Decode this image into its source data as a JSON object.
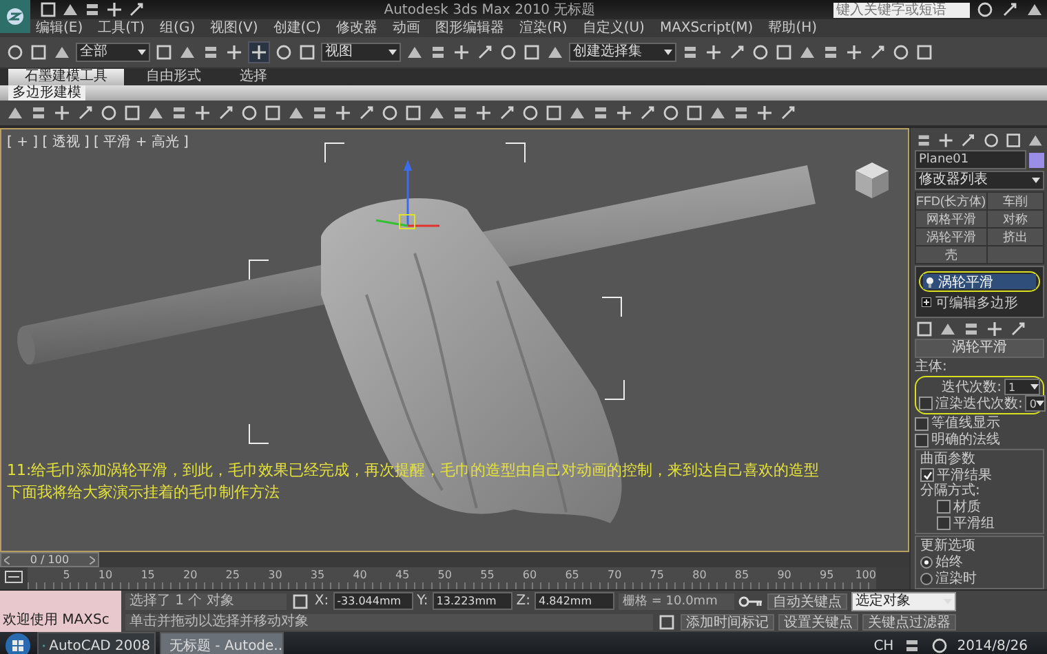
{
  "title_bar": {
    "title": "Autodesk 3ds Max 2010  无标题",
    "search": {
      "placeholder": "键入关键字或短语"
    }
  },
  "menu": [
    "编辑(E)",
    "工具(T)",
    "组(G)",
    "视图(V)",
    "创建(C)",
    "修改器",
    "动画",
    "图形编辑器",
    "渲染(R)",
    "自定义(U)",
    "MAXScript(M)",
    "帮助(H)"
  ],
  "main_toolbar": {
    "selection_filter": "全部",
    "reference_coord": "视图",
    "named_selection": "创建选择集"
  },
  "ribbon": {
    "tabs": [
      {
        "label": "石墨建模工具",
        "selected": true
      },
      {
        "label": "自由形式",
        "selected": false
      },
      {
        "label": "选择",
        "selected": false
      }
    ],
    "panel": "多边形建模"
  },
  "viewport": {
    "label": "[ + ] [ 透视 ] [ 平滑 + 高光 ]",
    "caption": [
      "11:给毛巾添加涡轮平滑，到此，毛巾效果已经完成，再次提醒，毛巾的造型由自己对动画的控制，来到达自己喜欢的造型",
      "下面我将给大家演示挂着的毛巾制作方法"
    ]
  },
  "command_panel": {
    "object_name": "Plane01",
    "modifier_list": "修改器列表",
    "modifier_buttons": [
      "FFD(长方体)",
      "车削",
      "网格平滑",
      "对称",
      "涡轮平滑",
      "挤出",
      "壳"
    ],
    "stack": [
      {
        "label": "涡轮平滑",
        "kind": "modifier",
        "selected": true
      },
      {
        "label": "可编辑多边形",
        "kind": "base",
        "selected": false
      }
    ],
    "rollout": {
      "title": "涡轮平滑",
      "section": "主体:",
      "iterations": {
        "label": "迭代次数:",
        "value": "1"
      },
      "render_iterations": {
        "label": "渲染迭代次数:",
        "value": "0",
        "checked": false
      },
      "options": [
        {
          "label": "等值线显示",
          "checked": false
        },
        {
          "label": "明确的法线",
          "checked": false
        }
      ],
      "surface": {
        "title": "曲面参数",
        "smooth_result": {
          "label": "平滑结果",
          "checked": true
        },
        "separate_by": "分隔方式:",
        "separate_options": [
          {
            "label": "材质",
            "checked": false
          },
          {
            "label": "平滑组",
            "checked": false
          }
        ]
      },
      "update": {
        "title": "更新选项",
        "options": [
          {
            "label": "始终",
            "selected": true
          },
          {
            "label": "渲染时",
            "selected": false
          }
        ]
      }
    }
  },
  "time_slider": {
    "position": "0 / 100",
    "level": 0
  },
  "ruler_labels": [
    "5",
    "10",
    "15",
    "20",
    "25",
    "30",
    "35",
    "40",
    "45",
    "50",
    "55",
    "60",
    "65",
    "70",
    "75",
    "80",
    "85",
    "90",
    "95",
    "100"
  ],
  "status": {
    "welcome": "欢迎使用 MAXSc",
    "prompt": "选择了 1 个 对象",
    "hint": "单击并拖动以选择并移动对象",
    "coords": [
      {
        "axis": "X:",
        "value": "-33.044mm"
      },
      {
        "axis": "Y:",
        "value": "13.223mm"
      },
      {
        "axis": "Z:",
        "value": "4.842mm"
      }
    ],
    "grid": "栅格 = 10.0mm",
    "add_time_tag": "添加时间标记",
    "auto_key": "自动关键点",
    "key_mode": "选定对象",
    "set_key": "设置关键点",
    "key_filters": "关键点过滤器"
  },
  "taskbar": {
    "tasks": [
      {
        "label": "AutoCAD 2008",
        "selected": false
      },
      {
        "label": "无标题 - Autode...",
        "selected": true
      }
    ],
    "language": "CH",
    "date": "2014/8/26"
  }
}
